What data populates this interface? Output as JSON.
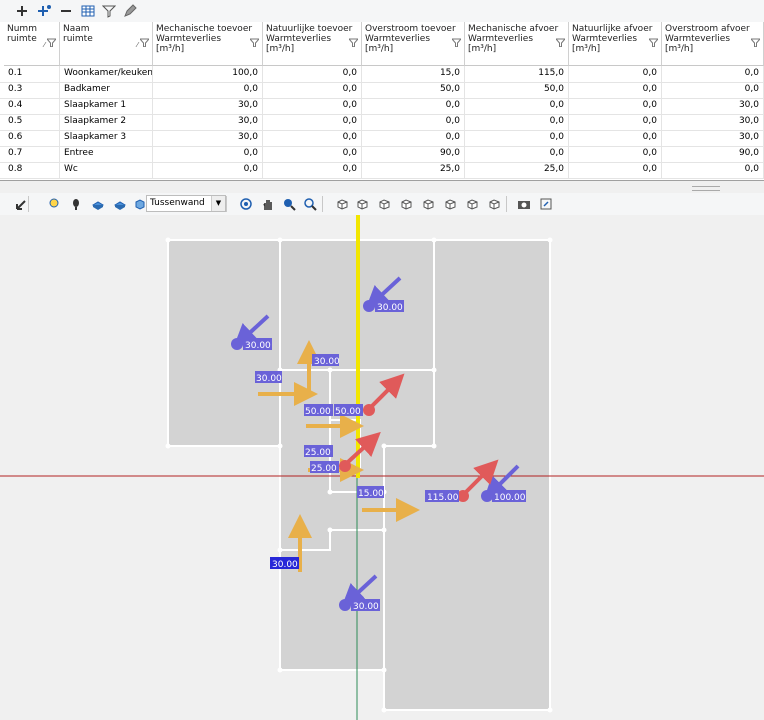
{
  "toolbar_top": {
    "icons": [
      "add-icon",
      "add-special-icon",
      "remove-icon",
      "table-icon",
      "filter-icon",
      "pencil-icon"
    ]
  },
  "table": {
    "columns": [
      {
        "title": "Numm\nruimte",
        "sort": "up"
      },
      {
        "title": "Naam\nruimte",
        "sort": "up"
      },
      {
        "title": "Mechanische toevoer\nWarmteverlies\n[m³/h]",
        "sort": ""
      },
      {
        "title": "Natuurlijke toevoer\nWarmteverlies\n[m³/h]",
        "sort": ""
      },
      {
        "title": "Overstroom toevoer\nWarmteverlies\n[m³/h]",
        "sort": ""
      },
      {
        "title": "Mechanische afvoer\nWarmteverlies\n[m³/h]",
        "sort": ""
      },
      {
        "title": "Natuurlijke afvoer\nWarmteverlies\n[m³/h]",
        "sort": ""
      },
      {
        "title": "Overstroom afvoer\nWarmteverlies\n[m³/h]",
        "sort": ""
      }
    ],
    "rows": [
      [
        "0.1",
        "Woonkamer/keuken",
        "100,0",
        "0,0",
        "15,0",
        "115,0",
        "0,0",
        "0,0"
      ],
      [
        "0.3",
        "Badkamer",
        "0,0",
        "0,0",
        "50,0",
        "50,0",
        "0,0",
        "0,0"
      ],
      [
        "0.4",
        "Slaapkamer 1",
        "30,0",
        "0,0",
        "0,0",
        "0,0",
        "0,0",
        "30,0"
      ],
      [
        "0.5",
        "Slaapkamer 2",
        "30,0",
        "0,0",
        "0,0",
        "0,0",
        "0,0",
        "30,0"
      ],
      [
        "0.6",
        "Slaapkamer 3",
        "30,0",
        "0,0",
        "0,0",
        "0,0",
        "0,0",
        "30,0"
      ],
      [
        "0.7",
        "Entree",
        "0,0",
        "0,0",
        "90,0",
        "0,0",
        "0,0",
        "90,0"
      ],
      [
        "0.8",
        "Wc",
        "0,0",
        "0,0",
        "25,0",
        "25,0",
        "0,0",
        "0,0"
      ]
    ]
  },
  "toolbar_view": {
    "wall_type": "Tussenwand",
    "icons": [
      "select-arrow-icon",
      "light-bulb-icon",
      "bulb-icon",
      "block-icon",
      "block-flat-icon",
      "cube-icon",
      "orbit-icon",
      "hand-pan-icon",
      "zoom-icon",
      "zoom-extents-icon",
      "view-iso-icon",
      "view-top-icon",
      "view-front-icon",
      "view-left-icon",
      "view-right-icon",
      "view-back-icon",
      "view-bottom-icon",
      "view-side-icon",
      "camera-icon",
      "export-icon"
    ]
  },
  "viewport": {
    "labels": [
      "30.00",
      "30.00",
      "30.00",
      "30.00",
      "50.00",
      "50.00",
      "25.00",
      "25.00",
      "15.00",
      "115.00",
      "100.00",
      "30.00",
      "30.00"
    ]
  }
}
